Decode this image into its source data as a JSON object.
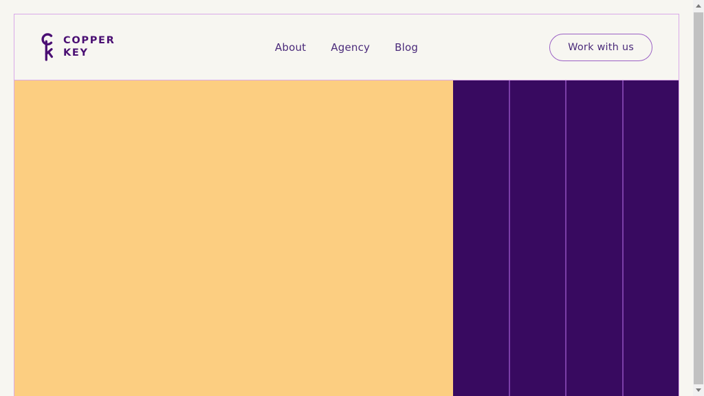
{
  "site": {
    "background_color": "#f7f6f1",
    "frame_border_color": "#d9a9e8"
  },
  "header": {
    "brand": {
      "mark_icon": "key-icon",
      "line1": "COPPER",
      "line2": "KEY",
      "color": "#4a0f73"
    },
    "nav": {
      "items": [
        {
          "label": "About"
        },
        {
          "label": "Agency"
        },
        {
          "label": "Blog"
        }
      ],
      "link_color": "#4a2a7a"
    },
    "cta": {
      "label": "Work with us",
      "border_color": "#9a5fc4",
      "text_color": "#4a2a7a"
    }
  },
  "hero": {
    "left_panel": {
      "color": "#fcce81"
    },
    "right_panel": {
      "color": "#380a60",
      "divider_color": "#7b3fa8",
      "columns": [
        {
          "id": "column-1"
        },
        {
          "id": "column-2"
        },
        {
          "id": "column-3"
        },
        {
          "id": "column-4"
        }
      ]
    }
  },
  "browser": {
    "scrollbar": {
      "up_arrow_icon": "caret-up-icon",
      "down_arrow_icon": "caret-down-icon",
      "track_color": "#f1f1f1",
      "thumb_color": "#c1c1c1"
    }
  }
}
